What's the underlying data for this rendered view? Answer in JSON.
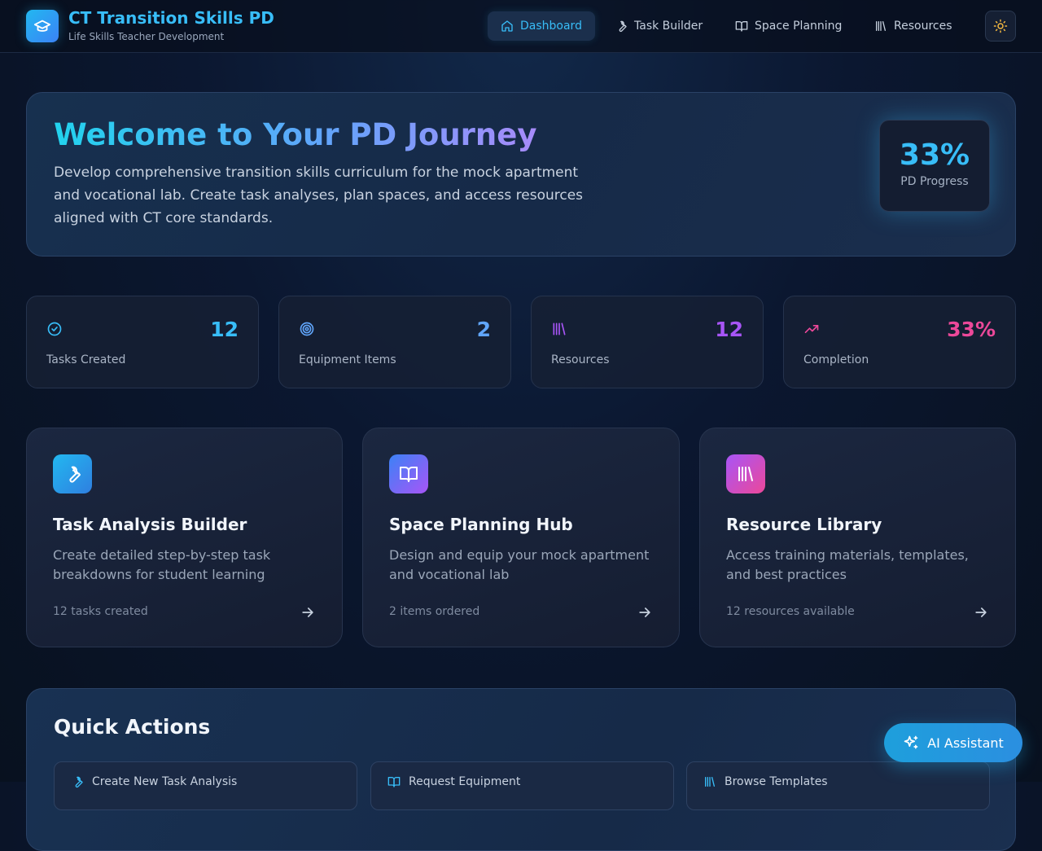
{
  "app": {
    "title": "CT Transition Skills PD",
    "subtitle": "Life Skills Teacher Development",
    "logo_icon": "graduation-cap-icon"
  },
  "nav": {
    "items": [
      {
        "label": "Dashboard",
        "icon": "home-icon",
        "active": true
      },
      {
        "label": "Task Builder",
        "icon": "wrench-icon",
        "active": false
      },
      {
        "label": "Space Planning",
        "icon": "book-open-icon",
        "active": false
      },
      {
        "label": "Resources",
        "icon": "library-icon",
        "active": false
      }
    ],
    "theme_toggle_icon": "sun-icon"
  },
  "hero": {
    "title": "Welcome to Your PD Journey",
    "description": "Develop comprehensive transition skills curriculum for the mock apartment and vocational lab. Create task analyses, plan spaces, and access resources aligned with CT core standards.",
    "progress_value": "33%",
    "progress_label": "PD Progress"
  },
  "stats": [
    {
      "value": "12",
      "label": "Tasks Created",
      "icon": "check-circle-icon",
      "color": "#38bdf8"
    },
    {
      "value": "2",
      "label": "Equipment Items",
      "icon": "target-icon",
      "color": "#60a5fa"
    },
    {
      "value": "12",
      "label": "Resources",
      "icon": "library-icon",
      "color": "#a855f7"
    },
    {
      "value": "33%",
      "label": "Completion",
      "icon": "trending-up-icon",
      "color": "#ec4899"
    }
  ],
  "features": [
    {
      "title": "Task Analysis Builder",
      "description": "Create detailed step-by-step task breakdowns for student learning",
      "meta": "12 tasks created",
      "icon": "wrench-icon"
    },
    {
      "title": "Space Planning Hub",
      "description": "Design and equip your mock apartment and vocational lab",
      "meta": "2 items ordered",
      "icon": "book-open-icon"
    },
    {
      "title": "Resource Library",
      "description": "Access training materials, templates, and best practices",
      "meta": "12 resources available",
      "icon": "library-icon"
    }
  ],
  "quick_actions": {
    "title": "Quick Actions",
    "items": [
      {
        "label": "Create New Task Analysis",
        "icon": "wrench-icon"
      },
      {
        "label": "Request Equipment",
        "icon": "book-open-icon"
      },
      {
        "label": "Browse Templates",
        "icon": "library-icon"
      }
    ]
  },
  "ai_assistant": {
    "label": "AI Assistant",
    "icon": "sparkles-icon"
  }
}
